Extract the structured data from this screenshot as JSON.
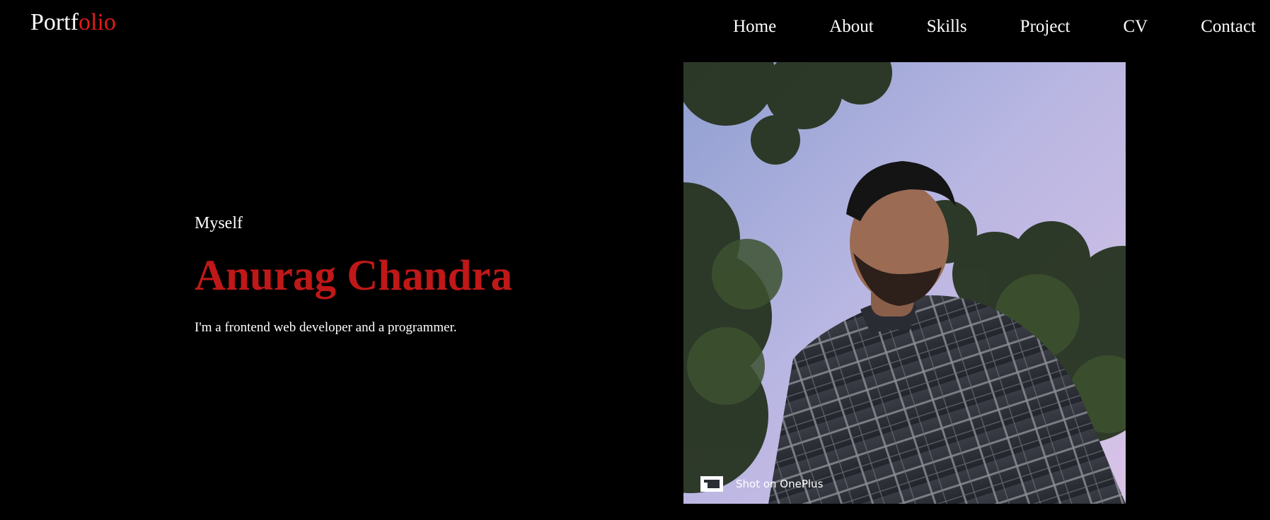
{
  "logo": {
    "part1": "Portf",
    "part2": "olio"
  },
  "nav": [
    "Home",
    "About",
    "Skills",
    "Project",
    "CV",
    "Contact"
  ],
  "hero": {
    "intro": "Myself",
    "name": "Anurag Chandra",
    "tagline": "I'm a frontend web developer and a programmer."
  },
  "photo": {
    "watermark": "Shot on OnePlus"
  },
  "colors": {
    "background": "#000000",
    "accent": "#c01818",
    "logo_accent": "#e21b1b",
    "text": "#ffffff"
  }
}
